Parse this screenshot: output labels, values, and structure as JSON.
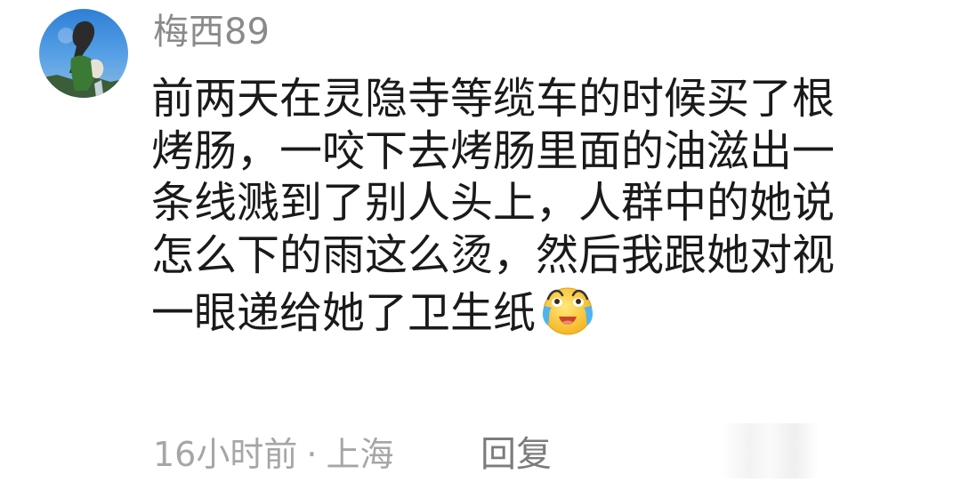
{
  "comment": {
    "username": "梅西89",
    "avatar_icon": "user-avatar-photo",
    "lines": [
      "前两天在灵隐寺等缆车的时候买了根",
      "烤肠，一咬下去烤肠里面的油滋出一",
      "条线溅到了别人头上，人群中的她说",
      "怎么下的雨这么烫，然后我跟她对视",
      "一眼递给她了卫生纸"
    ],
    "emoji_icon": "crying-laughing-emoji-icon",
    "time": "16小时前",
    "separator": "·",
    "location": "上海",
    "reply_label": "回复"
  },
  "colors": {
    "username": "#8a8a8a",
    "body_text": "#1a1a1a",
    "meta": "#a6a6a6",
    "reply": "#7c7c7c"
  }
}
